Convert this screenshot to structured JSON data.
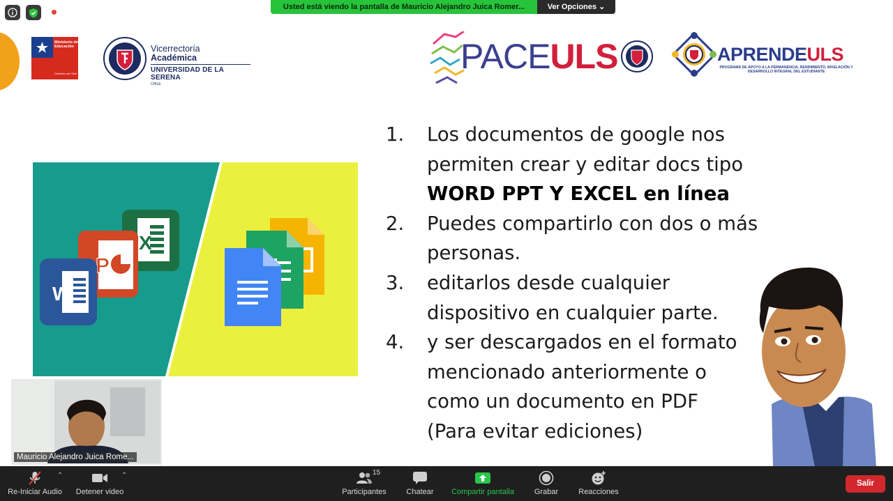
{
  "meeting": {
    "banner_text": "Usted está viendo la pantalla de Mauricio Alejandro Juica Romer...",
    "view_options_label": "Ver Opciones"
  },
  "header": {
    "minedu_line1": "Ministerio de",
    "minedu_line2": "Educación",
    "minedu_line3": "Gobierno de Chile",
    "va_line1": "Vicerrectoría",
    "va_line2": "Académica",
    "va_line3": "UNIVERSIDAD DE LA SERENA",
    "va_line4": "CHILE",
    "pace_part1": "PACE",
    "pace_part2": "ULS",
    "aprende_part1": "APRENDE",
    "aprende_part2": "ULS",
    "aprende_sub": "PROGRAMA DE APOYO A LA PERMANENCIA, RENDIMIENTO, NIVELACIÓN Y DESARROLLO INTEGRAL DEL ESTUDIANTE"
  },
  "slide": {
    "items": [
      {
        "num": "1.",
        "text_a": "Los documentos de google nos permiten crear y editar docs tipo ",
        "text_bold": "WORD PPT Y EXCEL en línea"
      },
      {
        "num": "2.",
        "text_a": "Puedes compartirlo con dos o más personas."
      },
      {
        "num": "3.",
        "text_a": "editarlos desde cualquier dispositivo en cualquier parte."
      },
      {
        "num": "4.",
        "text_a": "y ser descargados en el formato mencionado anteriormente o como un documento en PDF (Para evitar ediciones)"
      }
    ]
  },
  "participant": {
    "name": "Mauricio Alejandro Juica Rome..."
  },
  "toolbar": {
    "audio_label": "Re-Iniciar Audio",
    "video_label": "Detener video",
    "participants_label": "Participantes",
    "participants_count": "15",
    "chat_label": "Chatear",
    "share_label": "Compartir pantalla",
    "record_label": "Grabar",
    "reactions_label": "Reacciones",
    "leave_label": "Salir"
  },
  "colors": {
    "share_green": "#2ac64a",
    "banner_green": "#27c33a",
    "leave_red": "#d2282d",
    "toolbar_bg": "#1f1f1f"
  }
}
